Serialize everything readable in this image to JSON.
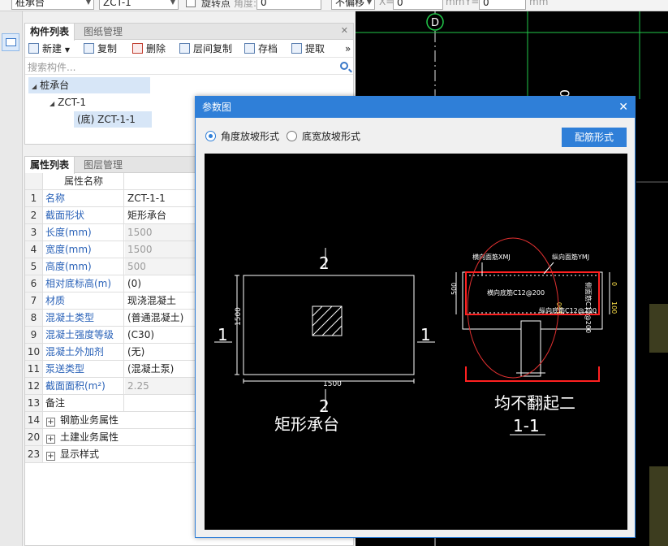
{
  "topbar": {
    "combo1": "桩承台",
    "combo2": "ZCT-1",
    "rotate_label": "旋转点",
    "angle_label": "角度:",
    "angle_value": "0",
    "offset_combo": "不偏移",
    "x_label": "X=",
    "x_value": "0",
    "x_unit": "mm",
    "y_label": "Y=",
    "y_value": "0",
    "y_unit": "mm"
  },
  "component_panel": {
    "tabs": [
      "构件列表",
      "图纸管理"
    ],
    "toolbar": {
      "new": "新建",
      "copy": "复制",
      "delete": "删除",
      "floor_copy": "层间复制",
      "save": "存档",
      "extract": "提取",
      "more": "»"
    },
    "search_placeholder": "搜索构件...",
    "tree": {
      "root": "桩承台",
      "child": "ZCT-1",
      "leaf": "(底) ZCT-1-1"
    }
  },
  "property_panel": {
    "tabs": [
      "属性列表",
      "图层管理"
    ],
    "header": "属性名称",
    "rows": [
      {
        "num": "1",
        "name": "名称",
        "value": "ZCT-1-1"
      },
      {
        "num": "2",
        "name": "截面形状",
        "value": "矩形承台"
      },
      {
        "num": "3",
        "name": "长度(mm)",
        "value": "1500"
      },
      {
        "num": "4",
        "name": "宽度(mm)",
        "value": "1500"
      },
      {
        "num": "5",
        "name": "高度(mm)",
        "value": "500"
      },
      {
        "num": "6",
        "name": "相对底标高(m)",
        "value": "(0)"
      },
      {
        "num": "7",
        "name": "材质",
        "value": "现浇混凝土"
      },
      {
        "num": "8",
        "name": "混凝土类型",
        "value": "(普通混凝土)"
      },
      {
        "num": "9",
        "name": "混凝土强度等级",
        "value": "(C30)"
      },
      {
        "num": "10",
        "name": "混凝土外加剂",
        "value": "(无)"
      },
      {
        "num": "11",
        "name": "泵送类型",
        "value": "(混凝土泵)"
      },
      {
        "num": "12",
        "name": "截面面积(m²)",
        "value": "2.25"
      },
      {
        "num": "13",
        "name": "备注",
        "value": ""
      },
      {
        "num": "14",
        "name": "钢筋业务属性",
        "value": ""
      },
      {
        "num": "20",
        "name": "土建业务属性",
        "value": ""
      },
      {
        "num": "23",
        "name": "显示样式",
        "value": ""
      }
    ]
  },
  "cad": {
    "axis_label": "D",
    "axis_label_2": "0"
  },
  "dialog": {
    "title": "参数图",
    "radio1": "角度放坡形式",
    "radio2": "底宽放坡形式",
    "button": "配筋形式",
    "drawing": {
      "plan_label": "矩形承台",
      "section_label": "1-1",
      "note": "均不翻起二",
      "num_1": "1",
      "num_2": "2",
      "dim_1500": "1500",
      "dim_500": "500",
      "dim_100": "100",
      "dim_0": "0",
      "rebar_top_x": "横向面筋XMJ",
      "rebar_top_y": "纵向面筋YMJ",
      "rebar_bottom_x": "横向底筋C12@200",
      "rebar_bottom_y": "纵向底筋C12@200",
      "side_rebar": "侧面筋C12@200"
    }
  }
}
